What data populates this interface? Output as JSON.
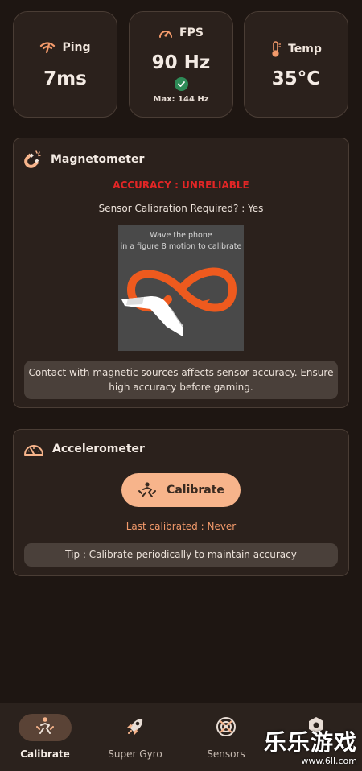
{
  "stats": {
    "ping": {
      "label": "Ping",
      "value": "7ms"
    },
    "fps": {
      "label": "FPS",
      "value": "90 Hz",
      "max": "Max: 144 Hz"
    },
    "temp": {
      "label": "Temp",
      "value": "35°C"
    }
  },
  "magnetometer": {
    "title": "Magnetometer",
    "accuracy": "ACCURACY : UNRELIABLE",
    "calibration_required": "Sensor Calibration Required? : Yes",
    "figure_text_1": "Wave the phone",
    "figure_text_2": "in a figure 8 motion to calibrate",
    "note": "Contact with magnetic sources affects sensor accuracy. Ensure high accuracy before gaming."
  },
  "accelerometer": {
    "title": "Accelerometer",
    "calibrate_label": "Calibrate",
    "last_calibrated": "Last calibrated : Never",
    "tip": "Tip : Calibrate periodically to maintain accuracy"
  },
  "nav": {
    "items": [
      {
        "label": "Calibrate",
        "icon": "calibrate-icon",
        "active": true
      },
      {
        "label": "Super Gyro",
        "icon": "rocket-icon",
        "active": false
      },
      {
        "label": "Sensors",
        "icon": "sensors-icon",
        "active": false
      },
      {
        "label": "",
        "icon": "gear-icon",
        "active": false
      }
    ]
  },
  "watermark": {
    "main": "乐乐游戏",
    "sub": "www.6ll.com"
  },
  "colors": {
    "background": "#1e1612",
    "card": "#2b211c",
    "accent": "#f39a6b",
    "button": "#f7b48b",
    "error": "#e22626",
    "success": "#2e8b57"
  }
}
